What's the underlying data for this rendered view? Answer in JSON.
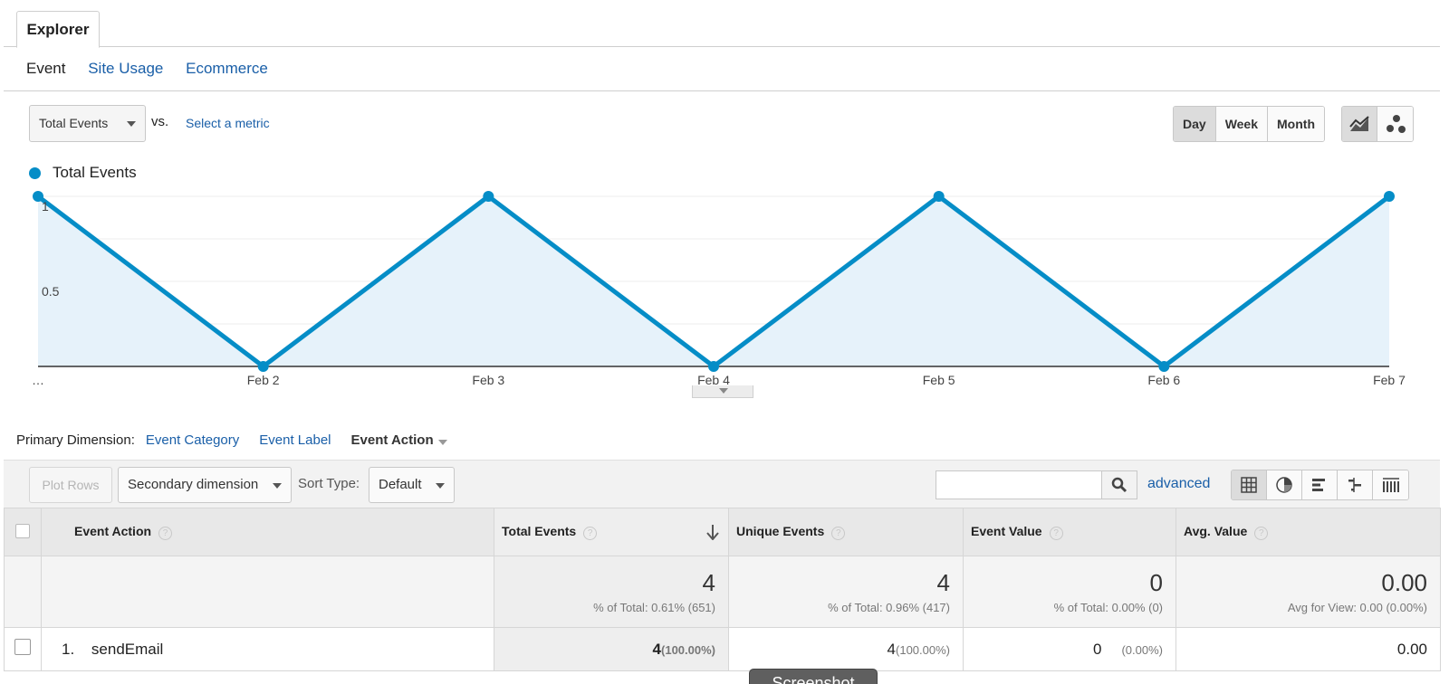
{
  "tabs": {
    "explorer": "Explorer"
  },
  "subnav": {
    "active": "Event",
    "links": [
      "Site Usage",
      "Ecommerce"
    ]
  },
  "metric": {
    "selected": "Total Events",
    "vs": "vs.",
    "select_metric": "Select a metric"
  },
  "period": {
    "day": "Day",
    "week": "Week",
    "month": "Month",
    "selected": "Day"
  },
  "chart_type_icons": [
    "line-chart-icon",
    "motion-chart-icon"
  ],
  "chart_data": {
    "type": "area",
    "x": [
      "…",
      "Feb 2",
      "Feb 3",
      "Feb 4",
      "Feb 5",
      "Feb 6",
      "Feb 7"
    ],
    "series": [
      {
        "name": "Total Events",
        "values": [
          1,
          0,
          1,
          0,
          1,
          0,
          1
        ]
      }
    ],
    "y_ticks": [
      "1",
      "0.5"
    ],
    "ylim": [
      0,
      1
    ],
    "grid": true,
    "legend": "top-left",
    "colors": {
      "line": "#058dc7",
      "fill": "#e6f2fa"
    }
  },
  "primary_dimension": {
    "label": "Primary Dimension:",
    "options": [
      "Event Category",
      "Event Label"
    ],
    "selected": "Event Action"
  },
  "toolbar": {
    "plot_rows": "Plot Rows",
    "secondary_dimension": "Secondary dimension",
    "sort_type_label": "Sort Type:",
    "sort_type": "Default",
    "search_value": "",
    "advanced": "advanced",
    "view_icons": [
      "table-view-icon",
      "pie-view-icon",
      "bar-view-icon",
      "comparison-view-icon",
      "pivot-view-icon"
    ]
  },
  "table": {
    "headers": [
      "Event Action",
      "Total Events",
      "Unique Events",
      "Event Value",
      "Avg. Value"
    ],
    "help_glyph": "?",
    "totals": [
      {
        "value": "4",
        "sub": "% of Total: 0.61% (651)"
      },
      {
        "value": "4",
        "sub": "% of Total: 0.96% (417)"
      },
      {
        "value": "0",
        "sub": "% of Total: 0.00% (0)"
      },
      {
        "value": "0.00",
        "sub": "Avg for View: 0.00 (0.00%)"
      }
    ],
    "rows": [
      {
        "index": "1.",
        "action": "sendEmail",
        "total_events": "4",
        "total_events_pct": "(100.00%)",
        "unique_events": "4",
        "unique_events_pct": "(100.00%)",
        "event_value": "0",
        "event_value_pct": "(0.00%)",
        "avg_value": "0.00"
      }
    ]
  },
  "tooltip": "Screenshot"
}
